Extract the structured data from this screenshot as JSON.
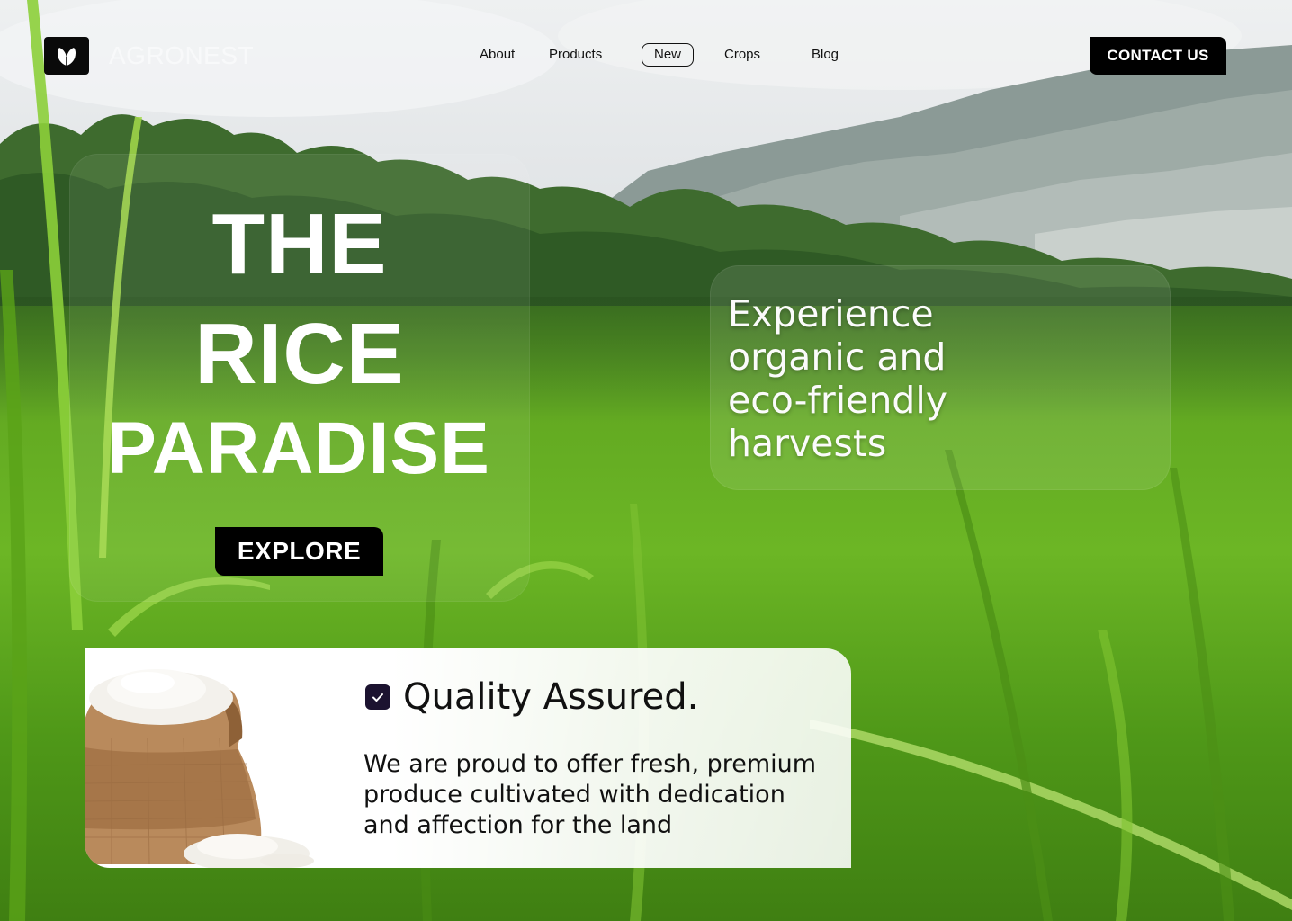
{
  "nav": {
    "brand": "AGRONEST",
    "logo_icon": "leaf-icon",
    "items": [
      {
        "label": "About"
      },
      {
        "label": "Products"
      },
      {
        "label": "New",
        "active": true
      },
      {
        "label": "Crops"
      },
      {
        "label": "Blog"
      }
    ],
    "contact_label": "CONTACT US"
  },
  "hero": {
    "line1": "THE",
    "line2": "RICE",
    "line3": "PARADISE",
    "explore_label": "EXPLORE"
  },
  "tagline": "Experience organic and eco-friendly harvests",
  "quality": {
    "icon": "checkbox-checked-icon",
    "title": "Quality Assured.",
    "body": "We are proud to offer fresh, premium produce cultivated with dedication and affection for the land",
    "image": "rice-sack-image"
  },
  "colors": {
    "button_bg": "#000000",
    "button_text": "#ffffff",
    "check_bg": "#1c1330",
    "grass": "#6cb625"
  }
}
